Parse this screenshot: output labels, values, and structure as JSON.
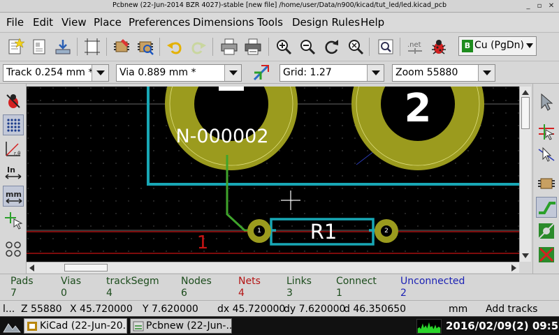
{
  "window": {
    "title": "Pcbnew (22-Jun-2014 BZR 4027)-stable  [new file] /home/user/Data/n900/kicad/tut_led/led.kicad_pcb",
    "minimize": "_",
    "maximize": "▫",
    "close": "✕"
  },
  "menu": [
    {
      "label": "File"
    },
    {
      "label": "Edit"
    },
    {
      "label": "View"
    },
    {
      "label": "Place"
    },
    {
      "label": "Preferences"
    },
    {
      "label": "Dimensions"
    },
    {
      "label": "Tools"
    },
    {
      "label": "Design Rules"
    },
    {
      "label": "Help"
    }
  ],
  "toolbar": {
    "layer_swatch": "B",
    "layer": "Cu (PgDn)"
  },
  "toolbar2": {
    "track_width": "Track 0.254 mm *",
    "via_size": "Via 0.889 mm *",
    "grid": "Grid: 1.27",
    "zoom": "Zoom 55880"
  },
  "canvas": {
    "net_label": "N-000002",
    "pad_number_big": "2",
    "component_ref": "R1",
    "pad1_label": "1",
    "pad2_label": "2",
    "layer_text": "1"
  },
  "colors": {
    "pad": "#9b9b1e",
    "track_green": "#3fa42b",
    "edge_cyan": "#18a7b5",
    "copper_red": "#c81414",
    "text_white": "#ffffff",
    "net_ok": "#1c4c1c",
    "net_warn": "#b41414",
    "net_unconnected": "#1c22b4"
  },
  "stats": [
    {
      "label": "Pads",
      "value": "7"
    },
    {
      "label": "Vias",
      "value": "0"
    },
    {
      "label": "trackSegm",
      "value": "4"
    },
    {
      "label": "Nodes",
      "value": "6"
    },
    {
      "label": "Nets",
      "value": "4"
    },
    {
      "label": "Links",
      "value": "3"
    },
    {
      "label": "Connect",
      "value": "1"
    },
    {
      "label": "Unconnected",
      "value": "2"
    }
  ],
  "status": {
    "field1": "l...",
    "zoom": "Z 55880",
    "x": "X 45.720000",
    "y": "Y 7.620000",
    "dx": "dx 45.720000",
    "dy": "dy 7.620000",
    "d": "d 46.350650",
    "units": "mm",
    "mode": "Add tracks"
  },
  "taskbar": {
    "task1": "KiCad (22-Jun-20...",
    "task2": "Pcbnew (22-Jun-...",
    "clock": "2016/02/09(2) 09:55PM"
  }
}
